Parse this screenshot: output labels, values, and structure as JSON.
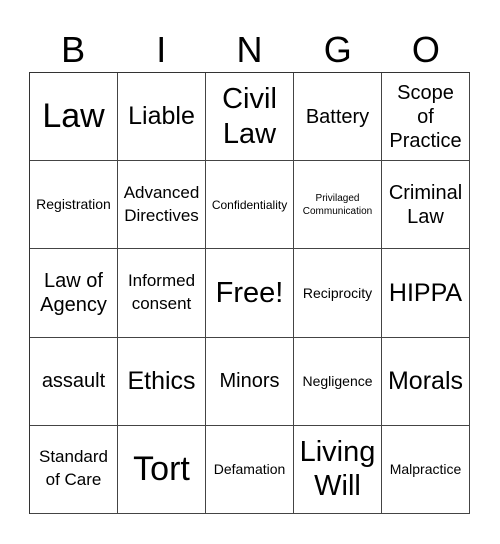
{
  "header": {
    "letters": [
      "B",
      "I",
      "N",
      "G",
      "O"
    ]
  },
  "card": {
    "rows": [
      [
        "Law",
        "Liable",
        "Civil\nLaw",
        "Battery",
        "Scope\nof\nPractice"
      ],
      [
        "Registration",
        "Advanced\nDirectives",
        "Confidentiality",
        "Privilaged\nCommunication",
        "Criminal\nLaw"
      ],
      [
        "Law of\nAgency",
        "Informed\nconsent",
        "Free!",
        "Reciprocity",
        "HIPPA"
      ],
      [
        "assault",
        "Ethics",
        "Minors",
        "Negligence",
        "Morals"
      ],
      [
        "Standard\nof Care",
        "Tort",
        "Defamation",
        "Living\nWill",
        "Malpractice"
      ]
    ]
  }
}
